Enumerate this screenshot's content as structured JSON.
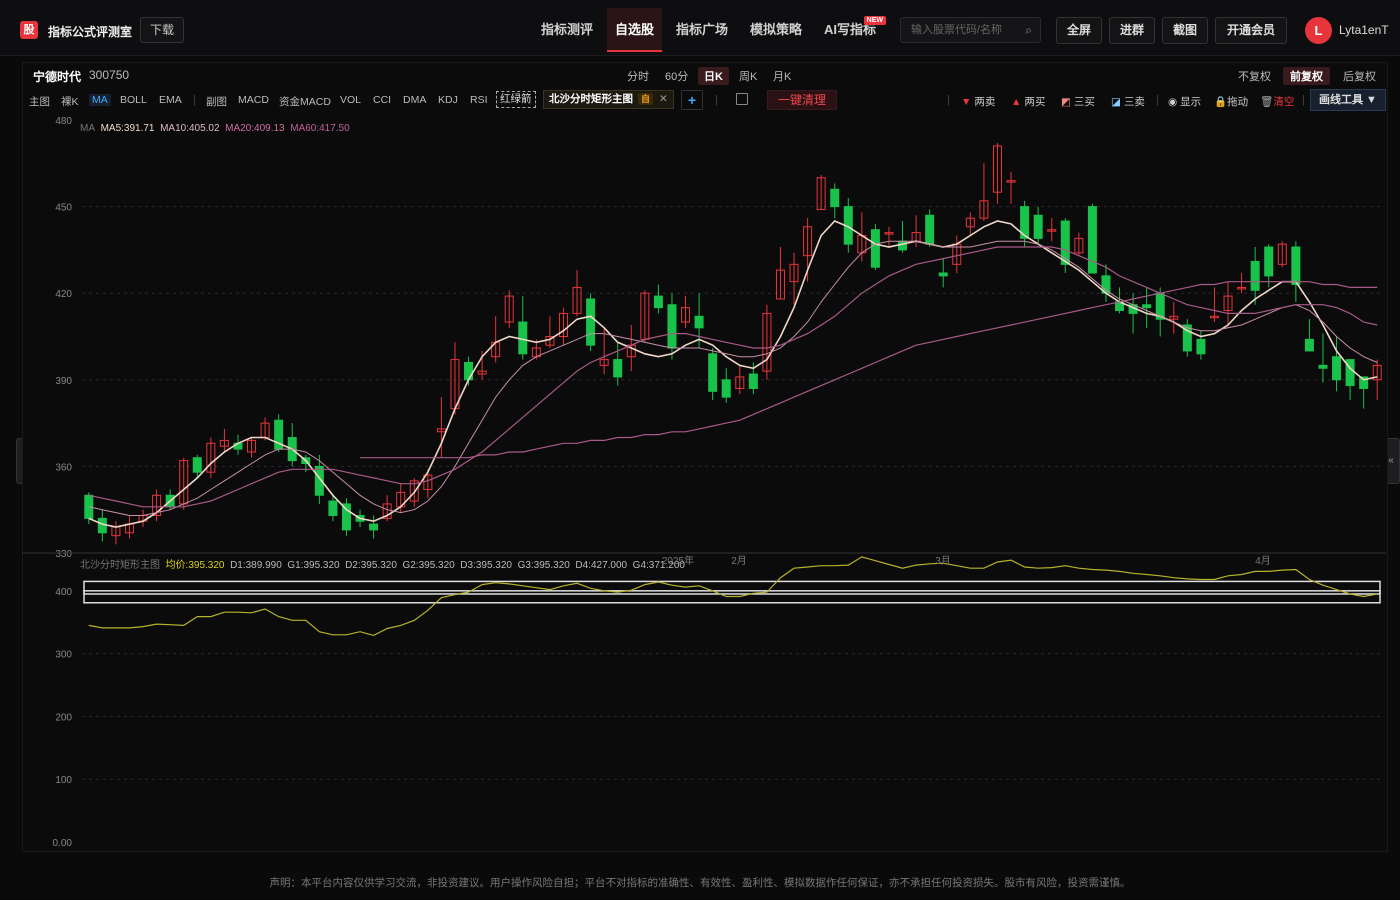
{
  "app": {
    "logo": "股",
    "name": "指标公式评测室",
    "download": "下载"
  },
  "nav": [
    "指标测评",
    "自选股",
    "指标广场",
    "模拟策略",
    "AI写指标"
  ],
  "nav_badge": "NEW",
  "search": {
    "placeholder": "输入股票代码/名称"
  },
  "tools": [
    "全屏",
    "进群",
    "截图",
    "开通会员"
  ],
  "user": {
    "avatar": "L",
    "name": "Lyta1enT"
  },
  "stock": {
    "name": "宁德时代",
    "code": "300750"
  },
  "periods": [
    "分时",
    "60分",
    "日K",
    "周K",
    "月K"
  ],
  "adjust": [
    "不复权",
    "前复权",
    "后复权"
  ],
  "toolbar": {
    "main": "主图",
    "naked": "裸K",
    "ma": "MA",
    "boll": "BOLL",
    "ema": "EMA",
    "sub": "副图",
    "macd": "MACD",
    "fund_macd": "资金MACD",
    "vol": "VOL",
    "cci": "CCI",
    "dma": "DMA",
    "kdj": "KDJ",
    "rsi": "RSI",
    "red_green": "红绿箭",
    "indicator_tag": "北沙分时矩形主图",
    "indicator_tag_badge": "自",
    "add": "+",
    "clear_all": "一键清理",
    "two_sell": "两卖",
    "two_buy": "两买",
    "three_buy": "三买",
    "three_sell": "三卖",
    "show": "显示",
    "drag": "拖动",
    "clear": "清空",
    "draw_tools": "画线工具 ▼"
  },
  "ma_legend": {
    "ma": "MA",
    "ma5": "MA5:391.71",
    "ma10": "MA10:405.02",
    "ma20": "MA20:409.13",
    "ma60": "MA60:417.50"
  },
  "sub_legend": {
    "name": "北沙分时矩形主图",
    "avg": "均价:395.320",
    "d1": "D1:389.990",
    "g1": "G1:395.320",
    "d2": "D2:395.320",
    "g2": "G2:395.320",
    "d3": "D3:395.320",
    "g3": "G3:395.320",
    "d4": "D4:427.000",
    "g4": "G4:371.200"
  },
  "main_yaxis": [
    "480",
    "450",
    "420",
    "390",
    "360",
    "330"
  ],
  "sub_yaxis": [
    "400",
    "300",
    "200",
    "100",
    "0.00"
  ],
  "x_labels": [
    "2025年",
    "2月",
    "3月",
    "4月"
  ],
  "disclaimer": "声明：本平台内容仅供学习交流，非投资建议。用户操作风险自担；平台不对指标的准确性、有效性、盈利性、模拟数据作任何保证，亦不承担任何投资损失。股市有风险，投资需谨慎。",
  "colors": {
    "up": "#e8353b",
    "down": "#19c24b",
    "ma5": "#f0d8c8",
    "ma10": "#c88ea0",
    "ma20": "#a85a80",
    "ma60": "#a85a80",
    "avg_line": "#b8b22a",
    "accent": "#e8353b"
  },
  "chart_data": {
    "type": "candlestick",
    "ylim": [
      330,
      480
    ],
    "x_labels": [
      "2025年",
      "2月",
      "3月",
      "4月"
    ],
    "candles": [
      [
        350,
        342,
        351,
        340
      ],
      [
        342,
        337,
        345,
        334
      ],
      [
        336,
        339,
        341,
        333
      ],
      [
        337,
        340,
        343,
        335
      ],
      [
        341,
        343,
        345,
        339
      ],
      [
        343,
        350,
        352,
        341
      ],
      [
        350,
        346,
        352,
        345
      ],
      [
        347,
        362,
        363,
        345
      ],
      [
        363,
        358,
        364,
        356
      ],
      [
        358,
        368,
        370,
        356
      ],
      [
        367,
        369,
        373,
        365
      ],
      [
        368,
        366,
        371,
        364
      ],
      [
        365,
        369,
        370,
        363
      ],
      [
        370,
        375,
        377,
        369
      ],
      [
        376,
        366,
        378,
        365
      ],
      [
        370,
        362,
        375,
        360
      ],
      [
        363,
        361,
        364,
        358
      ],
      [
        360,
        350,
        364,
        347
      ],
      [
        348,
        343,
        350,
        341
      ],
      [
        347,
        338,
        349,
        336
      ],
      [
        343,
        341,
        345,
        339
      ],
      [
        340,
        338,
        343,
        335
      ],
      [
        342,
        347,
        350,
        341
      ],
      [
        346,
        351,
        354,
        344
      ],
      [
        348,
        355,
        356,
        346
      ],
      [
        352,
        357,
        359,
        349
      ],
      [
        372,
        373,
        384,
        363
      ],
      [
        380,
        397,
        403,
        378
      ],
      [
        396,
        390,
        398,
        388
      ],
      [
        392,
        393,
        400,
        390
      ],
      [
        398,
        403,
        412,
        396
      ],
      [
        410,
        419,
        421,
        408
      ],
      [
        410,
        399,
        419,
        397
      ],
      [
        398,
        401,
        404,
        397
      ],
      [
        402,
        405,
        412,
        401
      ],
      [
        405,
        413,
        415,
        402
      ],
      [
        413,
        422,
        428,
        412
      ],
      [
        418,
        402,
        420,
        400
      ],
      [
        395,
        397,
        408,
        392
      ],
      [
        397,
        391,
        403,
        388
      ],
      [
        398,
        402,
        409,
        393
      ],
      [
        404,
        420,
        421,
        403
      ],
      [
        419,
        415,
        423,
        413
      ],
      [
        416,
        401,
        420,
        397
      ],
      [
        410,
        415,
        419,
        408
      ],
      [
        412,
        408,
        420,
        401
      ],
      [
        399,
        386,
        401,
        383
      ],
      [
        390,
        384,
        394,
        382
      ],
      [
        387,
        391,
        395,
        385
      ],
      [
        392,
        387,
        396,
        385
      ],
      [
        393,
        413,
        416,
        390
      ],
      [
        418,
        428,
        436,
        418
      ],
      [
        424,
        430,
        434,
        416
      ],
      [
        433,
        443,
        446,
        424
      ],
      [
        449,
        460,
        461,
        449
      ],
      [
        456,
        450,
        458,
        446
      ],
      [
        450,
        437,
        453,
        434
      ],
      [
        434,
        440,
        448,
        431
      ],
      [
        442,
        429,
        444,
        428
      ],
      [
        441,
        441,
        443,
        436
      ],
      [
        438,
        435,
        445,
        434
      ],
      [
        438,
        441,
        447,
        436
      ],
      [
        447,
        437,
        449,
        436
      ],
      [
        427,
        426,
        432,
        422
      ],
      [
        430,
        437,
        440,
        427
      ],
      [
        443,
        446,
        448,
        440
      ],
      [
        446,
        452,
        465,
        445
      ],
      [
        455,
        471,
        472,
        451
      ],
      [
        459,
        459,
        462,
        451
      ],
      [
        450,
        439,
        452,
        436
      ],
      [
        447,
        439,
        450,
        437
      ],
      [
        442,
        442,
        446,
        438
      ],
      [
        445,
        430,
        446,
        427
      ],
      [
        434,
        439,
        441,
        433
      ],
      [
        450,
        427,
        451,
        427
      ],
      [
        426,
        420,
        430,
        417
      ],
      [
        417,
        414,
        422,
        413
      ],
      [
        416,
        413,
        420,
        406
      ],
      [
        416,
        415,
        422,
        408
      ],
      [
        420,
        411,
        422,
        405
      ],
      [
        411,
        412,
        417,
        406
      ],
      [
        409,
        400,
        411,
        398
      ],
      [
        404,
        399,
        407,
        397
      ],
      [
        412,
        412,
        422,
        410
      ],
      [
        414,
        419,
        424,
        409
      ],
      [
        422,
        422,
        427,
        420
      ],
      [
        431,
        421,
        436,
        416
      ],
      [
        436,
        426,
        437,
        422
      ],
      [
        430,
        437,
        438,
        429
      ],
      [
        436,
        423,
        438,
        417
      ],
      [
        404,
        400,
        411,
        400
      ],
      [
        395,
        394,
        406,
        389
      ],
      [
        398,
        390,
        405,
        386
      ],
      [
        397,
        388,
        397,
        383
      ],
      [
        391,
        387,
        391,
        380
      ],
      [
        390,
        395,
        397,
        383
      ]
    ],
    "ma_lines": {
      "ma5": [
        342,
        340,
        339,
        340,
        341,
        344,
        348,
        352,
        356,
        361,
        365,
        368,
        370,
        370,
        368,
        366,
        362,
        356,
        350,
        345,
        342,
        341,
        343,
        346,
        351,
        358,
        368,
        380,
        390,
        398,
        403,
        405,
        404,
        403,
        404,
        407,
        411,
        412,
        408,
        403,
        401,
        399,
        398,
        399,
        402,
        404,
        402,
        398,
        395,
        394,
        397,
        405,
        415,
        428,
        440,
        445,
        443,
        440,
        437,
        436,
        437,
        438,
        437,
        436,
        437,
        440,
        443,
        445,
        444,
        440,
        437,
        434,
        431,
        428,
        424,
        420,
        417,
        415,
        413,
        412,
        410,
        407,
        405,
        406,
        409,
        414,
        418,
        421,
        424,
        424,
        417,
        409,
        400,
        394,
        390,
        391
      ],
      "ma10": [
        346,
        345,
        344,
        343,
        343,
        344,
        345,
        347,
        349,
        352,
        355,
        358,
        361,
        364,
        366,
        366,
        365,
        362,
        358,
        354,
        350,
        347,
        345,
        344,
        345,
        348,
        353,
        360,
        368,
        376,
        384,
        390,
        395,
        398,
        400,
        402,
        404,
        406,
        406,
        405,
        404,
        403,
        402,
        401,
        401,
        401,
        400,
        399,
        398,
        398,
        399,
        401,
        405,
        410,
        417,
        423,
        429,
        434,
        437,
        438,
        438,
        438,
        437,
        436,
        436,
        436,
        437,
        438,
        438,
        438,
        437,
        435,
        432,
        429,
        425,
        421,
        418,
        416,
        414,
        412,
        410,
        408,
        407,
        407,
        408,
        409,
        411,
        413,
        415,
        416,
        414,
        410,
        405,
        401,
        398,
        396
      ],
      "ma20": [
        350,
        349,
        348,
        347,
        346,
        346,
        346,
        346,
        347,
        348,
        350,
        352,
        354,
        356,
        358,
        359,
        359,
        359,
        359,
        358,
        357,
        356,
        355,
        354,
        354,
        355,
        357,
        359,
        362,
        365,
        369,
        373,
        377,
        381,
        385,
        389,
        393,
        396,
        398,
        400,
        402,
        404,
        405,
        406,
        406,
        405,
        404,
        403,
        402,
        401,
        401,
        402,
        404,
        406,
        409,
        412,
        416,
        420,
        423,
        426,
        428,
        430,
        431,
        432,
        433,
        434,
        435,
        436,
        436,
        436,
        436,
        436,
        435,
        433,
        431,
        429,
        426,
        424,
        422,
        420,
        418,
        416,
        415,
        414,
        413,
        413,
        413,
        414,
        415,
        416,
        416,
        416,
        415,
        413,
        410,
        409
      ],
      "ma60": [
        null,
        null,
        null,
        null,
        null,
        null,
        null,
        null,
        null,
        null,
        null,
        null,
        null,
        null,
        null,
        null,
        null,
        null,
        null,
        null,
        363,
        363,
        363,
        363,
        363,
        363,
        363,
        363,
        363,
        364,
        364,
        365,
        365,
        366,
        367,
        368,
        368,
        369,
        369,
        370,
        370,
        371,
        371,
        372,
        372,
        373,
        374,
        375,
        376,
        378,
        380,
        382,
        384,
        386,
        388,
        390,
        392,
        394,
        396,
        398,
        400,
        402,
        403,
        404,
        405,
        406,
        407,
        408,
        409,
        410,
        411,
        412,
        413,
        414,
        415,
        416,
        417,
        418,
        419,
        420,
        421,
        422,
        423,
        423,
        424,
        424,
        424,
        424,
        424,
        424,
        424,
        423,
        423,
        422,
        422,
        422
      ]
    },
    "sub_ylim": [
      0,
      430
    ],
    "avg_line": [
      345,
      341,
      341,
      341,
      343,
      347,
      346,
      345,
      359,
      359,
      366,
      366,
      365,
      371,
      359,
      353,
      353,
      335,
      330,
      330,
      335,
      329,
      340,
      345,
      353,
      369,
      389,
      394,
      398,
      410,
      413,
      411,
      408,
      405,
      402,
      408,
      412,
      404,
      400,
      398,
      401,
      410,
      414,
      409,
      406,
      408,
      400,
      391,
      391,
      396,
      398,
      421,
      436,
      438,
      440,
      440,
      441,
      454,
      448,
      442,
      436,
      441,
      443,
      444,
      440,
      436,
      436,
      446,
      449,
      438,
      436,
      437,
      440,
      436,
      434,
      433,
      431,
      428,
      426,
      424,
      421,
      419,
      418,
      418,
      424,
      426,
      431,
      431,
      433,
      434,
      418,
      409,
      402,
      395,
      391,
      395
    ],
    "rectangles": [
      {
        "top": 415,
        "bottom": 381
      },
      {
        "top": 400,
        "bottom": 395
      }
    ]
  }
}
